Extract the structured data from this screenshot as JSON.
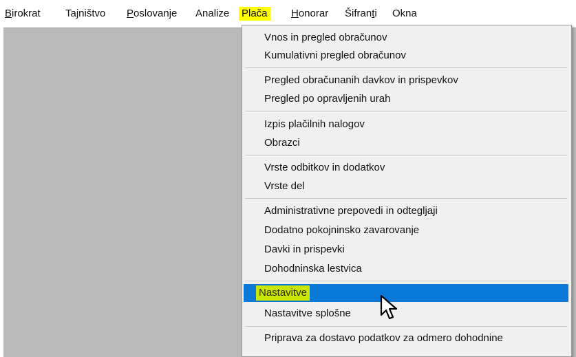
{
  "menubar": {
    "items": [
      {
        "label": "Birokrat",
        "mnemonic": "B",
        "rest": "irokrat"
      },
      {
        "label": "Tajništvo"
      },
      {
        "label": "Poslovanje",
        "mnemonic": "P",
        "rest": "oslovanje"
      },
      {
        "label": "Analize"
      },
      {
        "label": "Plača",
        "active": true
      },
      {
        "label": "Honorar",
        "mnemonic": "H",
        "rest": "onorar"
      },
      {
        "label": "Šifranti",
        "pre": "Šifran",
        "mnemonic": "t",
        "rest": "i"
      },
      {
        "label": "Okna"
      }
    ]
  },
  "dropdown": {
    "items": [
      "Vnos in pregled obračunov",
      "Kumulativni pregled obračunov",
      "Pregled obračunanih davkov in prispevkov",
      "Pregled po opravljenih urah",
      "Izpis plačilnih nalogov",
      "Obrazci",
      "Vrste odbitkov in dodatkov",
      "Vrste del",
      "Administrativne prepovedi in odtegljaji",
      "Dodatno pokojninsko zavarovanje",
      "Davki in prispevki",
      "Dohodninska lestvica",
      "Nastavitve",
      "Nastavitve splošne",
      "Priprava za dostavo podatkov za odmero dohodnine"
    ],
    "selected_label": "Nastavitve"
  },
  "colors": {
    "menu_highlight": "#ffff00",
    "selection_bg": "#0a78d7",
    "selection_label_highlight": "#c8e600",
    "client_bg": "#b9b9b9",
    "menu_bg": "#f0f0f0"
  },
  "icons": {
    "cursor": "arrow-cursor-icon"
  }
}
